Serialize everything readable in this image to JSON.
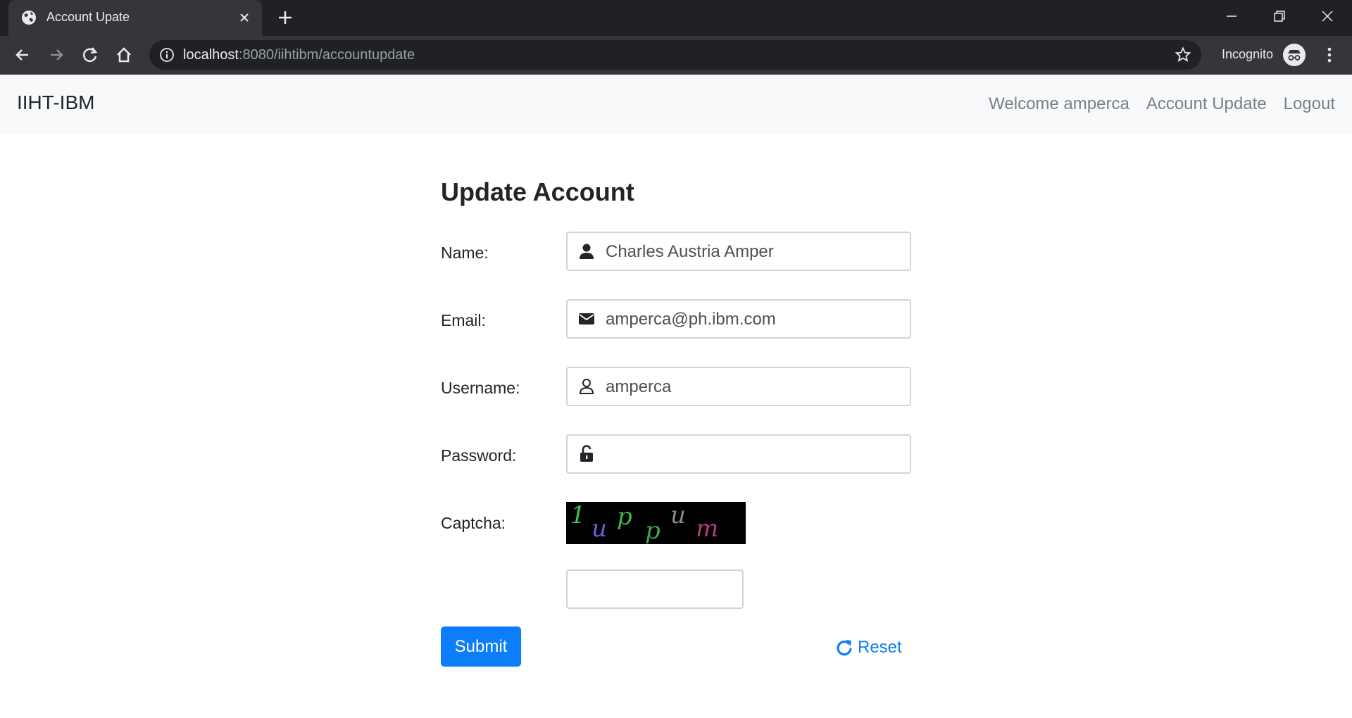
{
  "browser": {
    "tab_title": "Account Upate",
    "url_host": "localhost",
    "url_path": ":8080/iihtibm/accountupdate",
    "incognito_label": "Incognito",
    "icons": [
      "globe-icon",
      "close-icon",
      "plus-icon",
      "back-arrow-icon",
      "forward-arrow-icon",
      "reload-icon",
      "home-icon",
      "info-icon",
      "star-icon",
      "incognito-icon",
      "kebab-menu-icon",
      "minimize-icon",
      "restore-icon",
      "window-close-icon"
    ]
  },
  "navbar": {
    "brand": "IIHT-IBM",
    "links": [
      "Welcome amperca",
      "Account Update",
      "Logout"
    ]
  },
  "form": {
    "title": "Update Account",
    "fields": {
      "name": {
        "label": "Name:",
        "value": "Charles Austria Amper",
        "icon": "user-icon"
      },
      "email": {
        "label": "Email:",
        "value": "amperca@ph.ibm.com",
        "icon": "envelope-icon"
      },
      "username": {
        "label": "Username:",
        "value": "amperca",
        "icon": "user-outline-icon"
      },
      "password": {
        "label": "Password:",
        "value": "",
        "icon": "unlock-icon"
      }
    },
    "captcha": {
      "label": "Captcha:",
      "chars": [
        "1",
        "u",
        "p",
        "p",
        "u",
        "m"
      ],
      "input_value": ""
    },
    "submit_label": "Submit",
    "reset_label": "Reset",
    "colors": {
      "primary": "#0d7dfb",
      "navbar_bg": "#f8f9fa",
      "text": "#212529"
    }
  }
}
